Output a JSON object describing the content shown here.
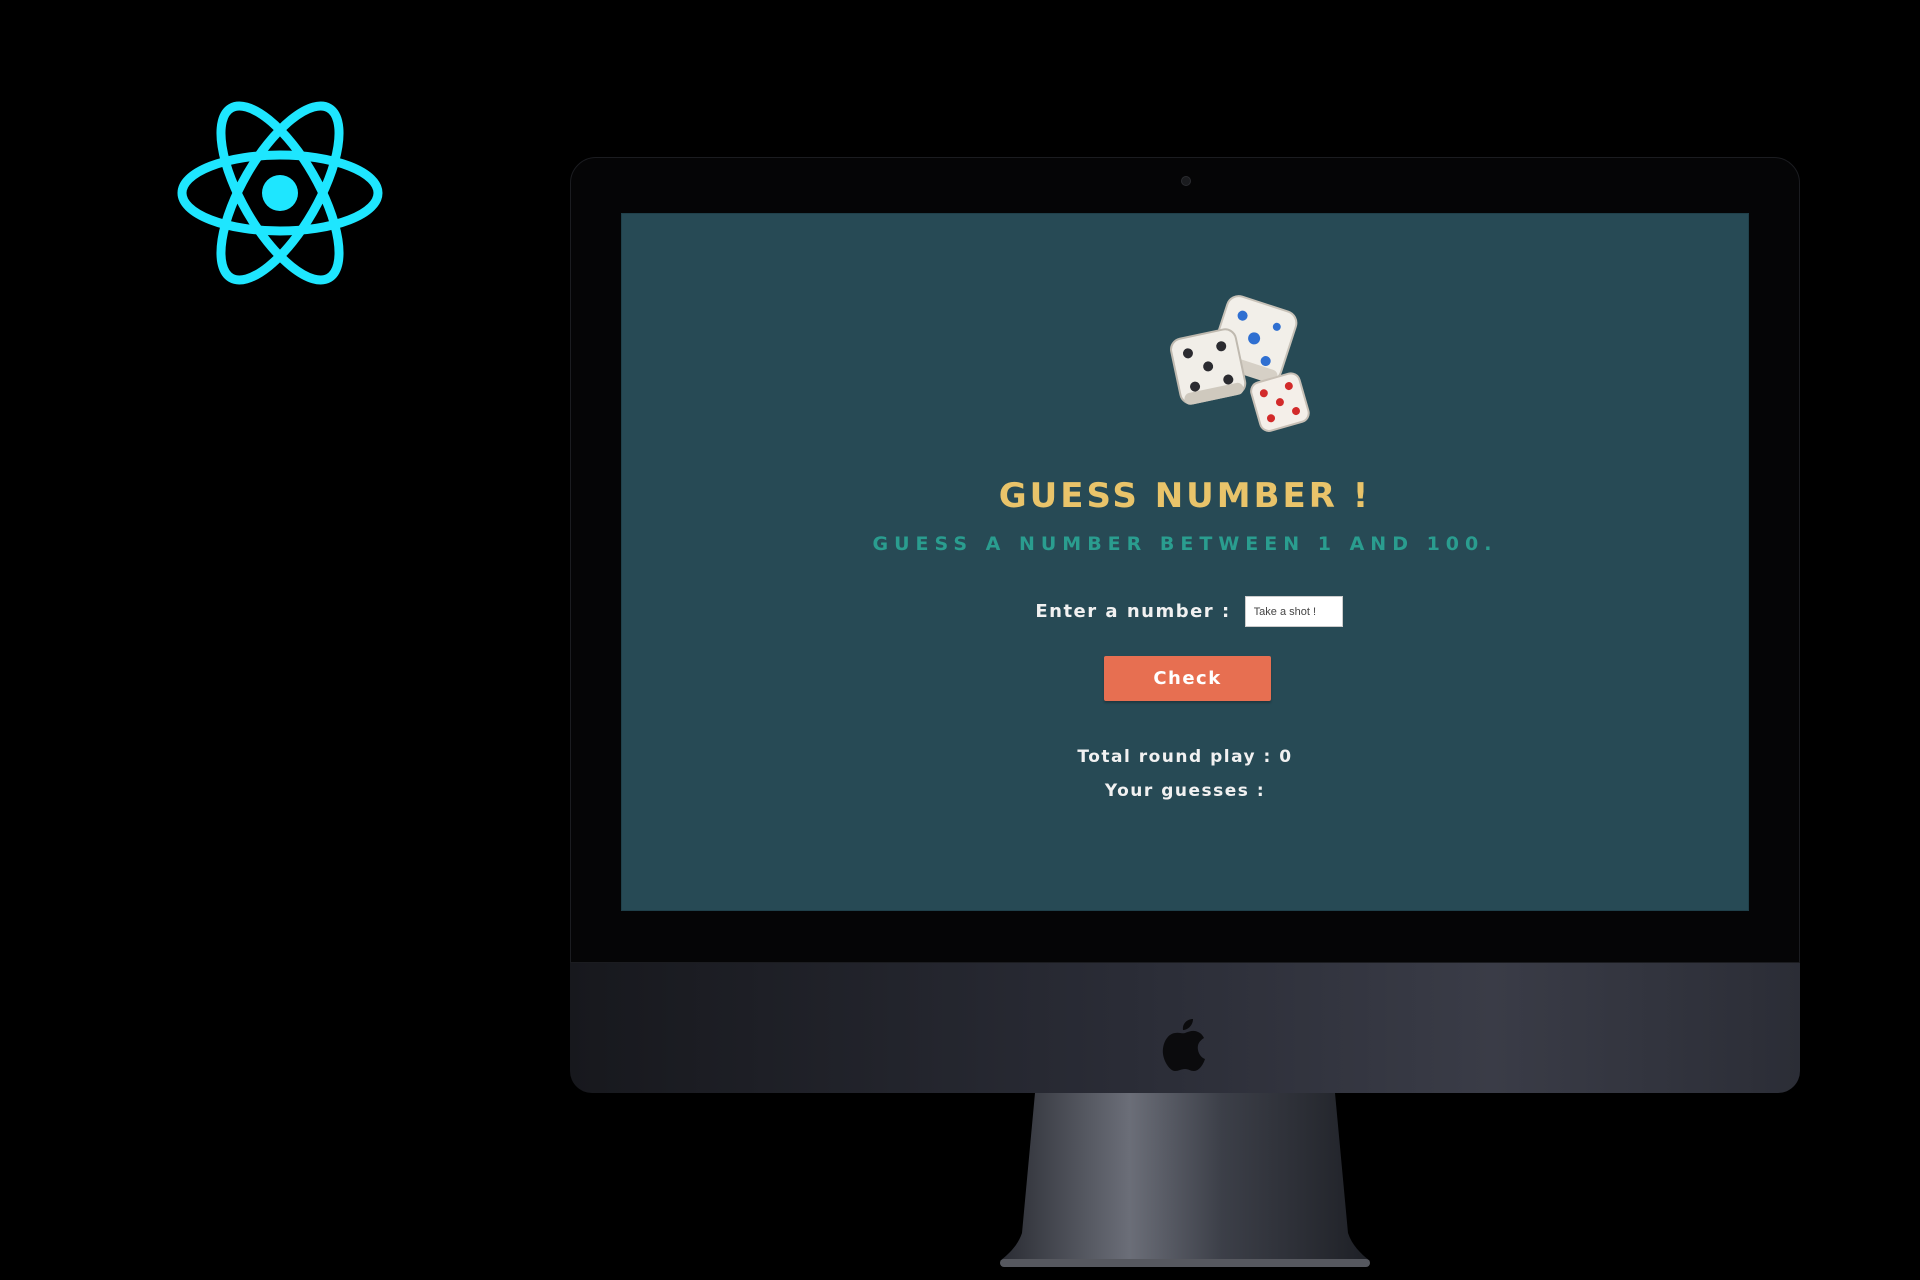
{
  "app": {
    "title": "GUESS NUMBER !",
    "subtitle": "GUESS A NUMBER BETWEEN 1 AND 100.",
    "entry_label": "Enter a number :",
    "input_placeholder": "Take a shot !",
    "input_value": "",
    "check_label": "Check",
    "round_label": "Total round play :",
    "round_count": "0",
    "guesses_label": "Your guesses :",
    "guesses": ""
  },
  "colors": {
    "screen_bg": "#274a55",
    "title": "#e9c46a",
    "subtitle": "#2a9d8f",
    "button": "#e76f51",
    "react_logo": "#1ee6ff"
  },
  "icons": [
    "react-logo-icon",
    "dice-icon",
    "apple-icon"
  ]
}
